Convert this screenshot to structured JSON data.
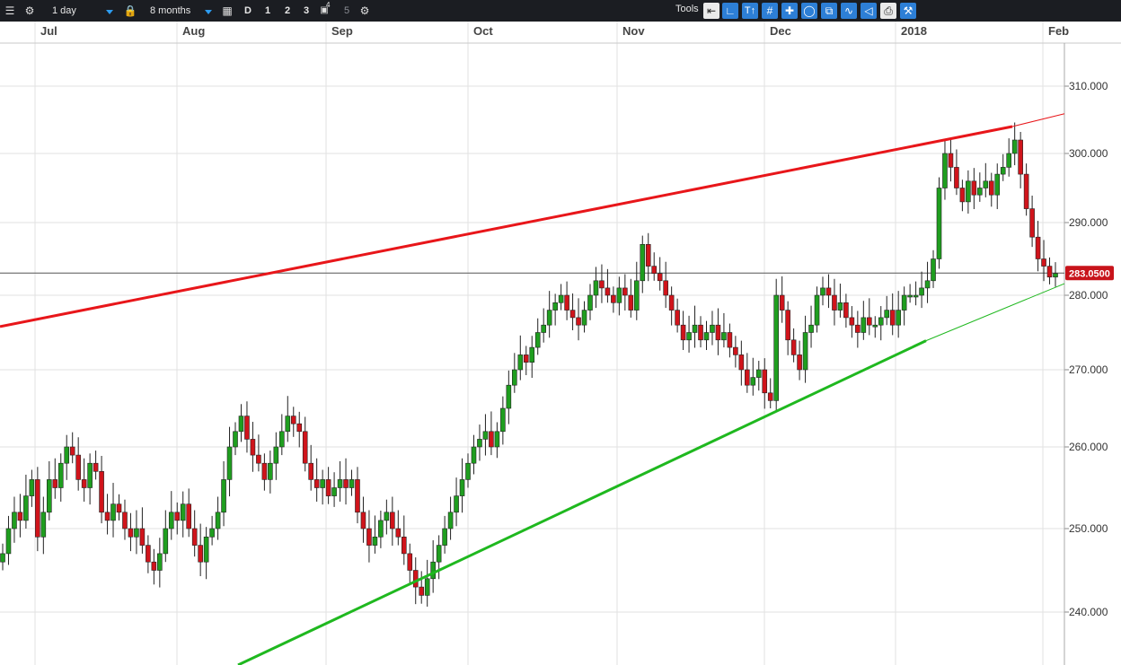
{
  "toolbar": {
    "interval": "1 day",
    "range": "8 months",
    "d_label": "D",
    "layout_1": "1",
    "layout_2": "2",
    "layout_3": "3",
    "layout_4": "4",
    "layout_5": "5",
    "tools_label": "Tools",
    "icons": [
      "list-icon",
      "gear-icon",
      "lock-icon",
      "calendar-icon",
      "window-icon",
      "gear-icon",
      "undo-icon",
      "curve-icon",
      "text-tool-icon",
      "grid-icon",
      "crosshair-icon",
      "draw-icon",
      "compare-icon",
      "indicator-icon",
      "label-icon",
      "print-icon",
      "wrench-icon"
    ]
  },
  "chart_data": {
    "type": "candlestick",
    "x_labels": [
      "Jul",
      "Aug",
      "Sep",
      "Oct",
      "Nov",
      "Dec",
      "2018",
      "Feb"
    ],
    "y_ticks": [
      "240.000",
      "250.000",
      "260.000",
      "270.000",
      "280.000",
      "290.000",
      "300.000",
      "310.000"
    ],
    "current_price": "283.0500",
    "colors": {
      "up": "#1f9e1f",
      "down": "#d0141b",
      "resistance": "#e8161a",
      "support": "#1fb81f",
      "price_badge": "#c8141b"
    },
    "grid": true,
    "trendlines": [
      {
        "name": "resistance",
        "from": [
          "2017-06-22",
          275.8
        ],
        "to": [
          "2018-01-26",
          304.3
        ]
      },
      {
        "name": "support",
        "from": [
          "2017-08-30",
          235.0
        ],
        "to": [
          "2018-01-05",
          274.0
        ]
      }
    ]
  }
}
